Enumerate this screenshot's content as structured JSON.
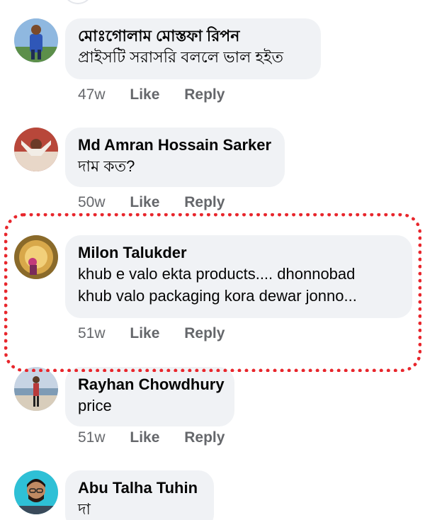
{
  "comments": [
    {
      "author": "মোঃগোলাম মোস্তফা রিপন",
      "text_lines": [
        "প্রাইসটি সরাসরি বললে ভাল হইত"
      ],
      "time": "47w",
      "like": "Like",
      "reply": "Reply",
      "avatar_icon": "profile-photo"
    },
    {
      "author": "Md Amran Hossain Sarker",
      "text_lines": [
        "দাম কত?"
      ],
      "time": "50w",
      "like": "Like",
      "reply": "Reply",
      "avatar_icon": "profile-photo"
    },
    {
      "author": "Milon Talukder",
      "text_lines": [
        "khub e valo ekta products.... dhonnobad",
        "khub valo packaging kora dewar jonno..."
      ],
      "time": "51w",
      "like": "Like",
      "reply": "Reply",
      "avatar_icon": "profile-photo"
    },
    {
      "author": "Rayhan Chowdhury",
      "text_lines": [
        "price"
      ],
      "time": "51w",
      "like": "Like",
      "reply": "Reply",
      "avatar_icon": "profile-photo"
    },
    {
      "author": "Abu Talha Tuhin",
      "text_lines": [
        "দা"
      ],
      "avatar_icon": "profile-photo"
    }
  ],
  "colors": {
    "bubble": "#f0f2f5",
    "meta_text": "#65676b",
    "highlight_border": "#e8262c"
  }
}
